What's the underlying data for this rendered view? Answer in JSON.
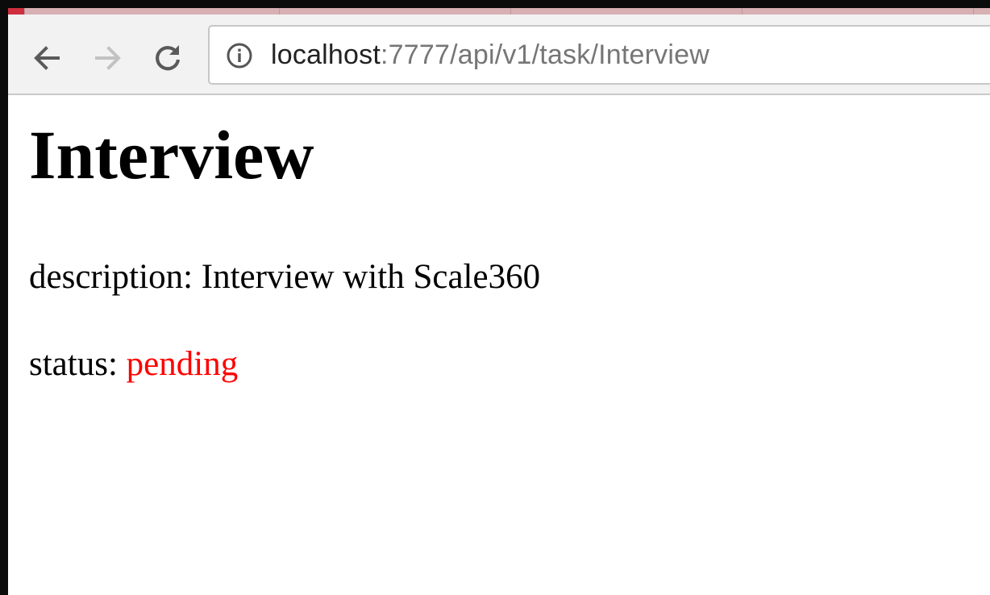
{
  "browser": {
    "url_host": "localhost",
    "url_path": ":7777/api/v1/task/Interview"
  },
  "task": {
    "title": "Interview",
    "description_label": "description: ",
    "description_value": "Interview with Scale360",
    "status_label": "status: ",
    "status_value": "pending",
    "status_color": "#ff0000"
  },
  "icons": {
    "back": "back-arrow-icon",
    "forward": "forward-arrow-icon",
    "reload": "reload-icon",
    "info": "info-icon"
  },
  "colors": {
    "tab_active": "#cf2f3e",
    "tab_inactive": "#d7b0b4",
    "toolbar": "#f2f2f2"
  }
}
